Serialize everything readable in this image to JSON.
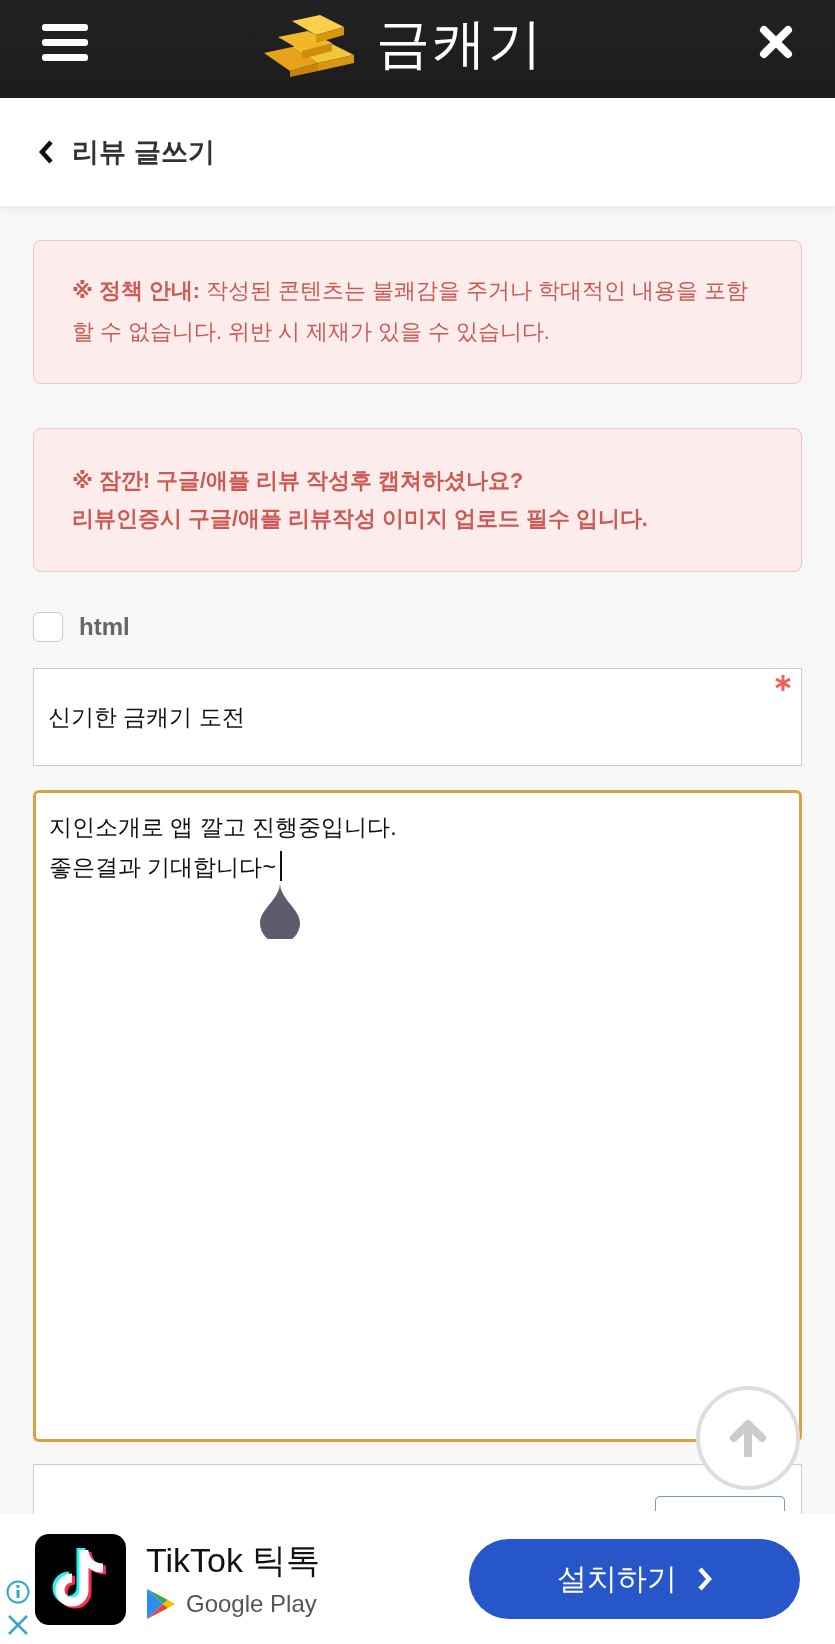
{
  "header": {
    "logo_text": "금캐기"
  },
  "page_title": "리뷰 글쓰기",
  "notices": [
    {
      "kind": "policy",
      "lines": [
        "**※ 정책 안내:** 작성된 콘텐츠는 불쾌감을 주거나 학대적인 내용을 포함할 수 없습니다. 위반 시 제재가 있을 수 있습니다."
      ]
    },
    {
      "kind": "reminder",
      "lines": [
        "※ 잠깐! 구글/애플 리뷰 작성후 캡쳐하셨나요?",
        "리뷰인증시 구글/애플 리뷰작성 이미지 업로드 필수 입니다."
      ]
    }
  ],
  "html_checkbox": {
    "label": "html",
    "checked": false
  },
  "title_field": {
    "value": "신기한 금캐기 도전",
    "required": true
  },
  "content_field": {
    "lines": [
      "지인소개로 앱 깔고 진행중입니다.",
      "좋은결과 기대합니다~"
    ],
    "focused": true
  },
  "ad": {
    "app_name": "TikTok 틱톡",
    "store": "Google Play",
    "install_button": "설치하기"
  }
}
